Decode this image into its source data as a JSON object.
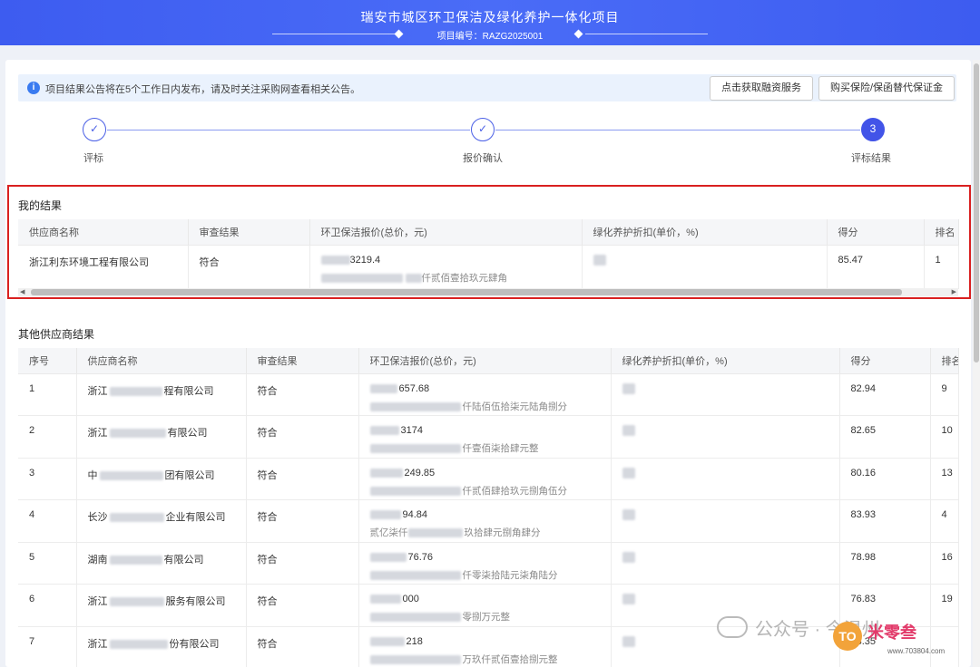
{
  "header": {
    "title": "瑞安市城区环卫保洁及绿化养护一体化项目",
    "project_no": "项目编号：RAZG2025001"
  },
  "notice": {
    "text": "项目结果公告将在5个工作日内发布，请及时关注采购网查看相关公告。",
    "btn_finance": "点击获取融资服务",
    "btn_insurance": "购买保险/保函替代保证金"
  },
  "steps": [
    {
      "label": "评标",
      "mark": "✓"
    },
    {
      "label": "报价确认",
      "mark": "✓"
    },
    {
      "label": "评标结果",
      "mark": "3"
    }
  ],
  "my_result": {
    "title": "我的结果",
    "headers": [
      "供应商名称",
      "审查结果",
      "环卫保洁报价(总价，元)",
      "绿化养护折扣(单价，%)",
      "得分",
      "排名"
    ],
    "row": {
      "supplier": "浙江利东环境工程有限公司",
      "review": "符合",
      "price_visible": "3219.4",
      "price_words_visible": "仟贰佰壹拾玖元肆角",
      "discount": "",
      "score": "85.47",
      "rank": "1"
    }
  },
  "others": {
    "title": "其他供应商结果",
    "headers": [
      "序号",
      "供应商名称",
      "审查结果",
      "环卫保洁报价(总价，元)",
      "绿化养护折扣(单价，%)",
      "得分",
      "排名"
    ],
    "rows": [
      {
        "no": "1",
        "name_pre": "浙江",
        "name_post": "程有限公司",
        "review": "符合",
        "price": "657.68",
        "words": "仟陆佰伍拾柒元陆角捌分",
        "score": "82.94",
        "rank": "9"
      },
      {
        "no": "2",
        "name_pre": "浙江",
        "name_post": "有限公司",
        "review": "符合",
        "price": "3174",
        "words": "仟壹佰柒拾肆元整",
        "score": "82.65",
        "rank": "10"
      },
      {
        "no": "3",
        "name_pre": "中",
        "name_post": "团有限公司",
        "review": "符合",
        "price": "249.85",
        "words": "仟贰佰肆拾玖元捌角伍分",
        "score": "80.16",
        "rank": "13"
      },
      {
        "no": "4",
        "name_pre": "长沙",
        "name_post": "企业有限公司",
        "review": "符合",
        "price": "94.84",
        "words": "玖拾肆元捌角肆分",
        "words_pre": "贰亿柒仟",
        "score": "83.93",
        "rank": "4"
      },
      {
        "no": "5",
        "name_pre": "湖南",
        "name_post": "有限公司",
        "review": "符合",
        "price": "76.76",
        "words": "仟零柒拾陆元柒角陆分",
        "score": "78.98",
        "rank": "16"
      },
      {
        "no": "6",
        "name_pre": "浙江",
        "name_post": "服务有限公司",
        "review": "符合",
        "price": "000",
        "words": "零捌万元整",
        "score": "76.83",
        "rank": "19"
      },
      {
        "no": "7",
        "name_pre": "浙江",
        "name_post": "份有限公司",
        "review": "符合",
        "price": "218",
        "words": "万玖仟贰佰壹拾捌元整",
        "score": "83.35",
        "rank": ""
      }
    ]
  },
  "watermark": {
    "text": "公众号 · 今温州",
    "logo": "TO",
    "brand": "米零叁",
    "url": "www.703804.com"
  }
}
